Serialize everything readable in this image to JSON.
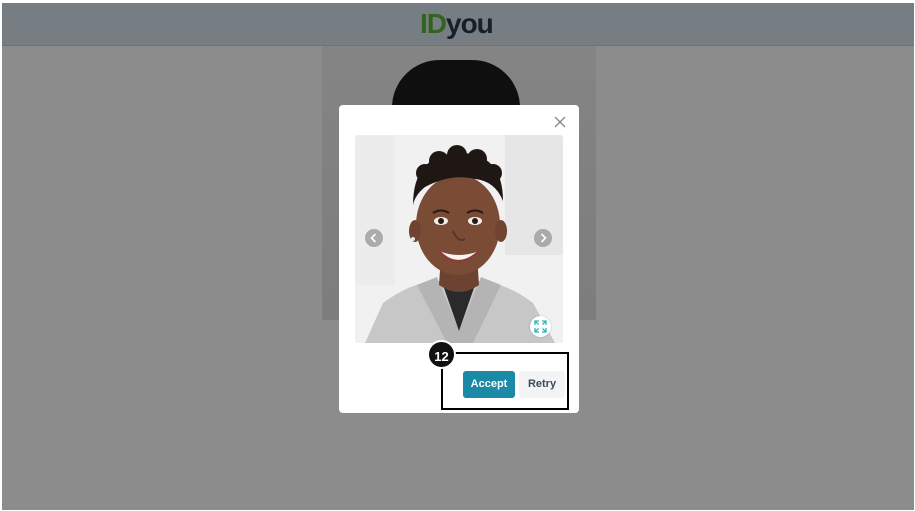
{
  "header": {
    "logo_id": "ID",
    "logo_you": "you"
  },
  "modal": {
    "accept_label": "Accept",
    "retry_label": "Retry"
  },
  "callout": {
    "number": "12"
  },
  "icons": {
    "close": "close-icon",
    "prev": "chevron-left-icon",
    "next": "chevron-right-icon",
    "expand": "expand-icon"
  },
  "colors": {
    "accent": "#1a8aa6",
    "logo_green": "#5fb23a",
    "logo_navy": "#2a3a49",
    "expand_icon": "#2fb3b3"
  }
}
